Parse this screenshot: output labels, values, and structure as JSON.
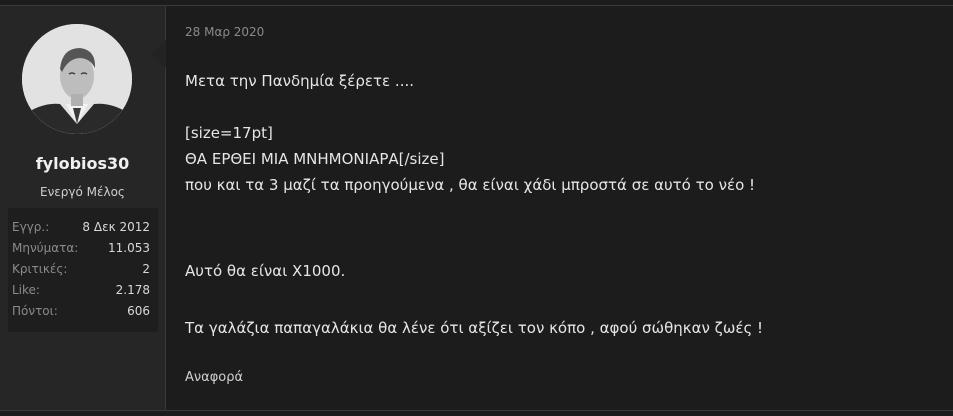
{
  "post": {
    "date": "28 Μαρ 2020",
    "lines": [
      "Μετα την Πανδημία ξέρετε ....",
      "[size=17pt]",
      "ΘΑ ΕΡΘΕΙ ΜΙΑ ΜΝΗΜΟΝΙΑΡΑ[/size]",
      "που και τα 3 μαζί τα προηγούμενα , θα είναι χάδι μπροστά σε αυτό το νέο !",
      "Αυτό θα είναι Χ1000.",
      "Τα γαλάζια παπαγαλάκια θα λένε ότι αξίζει τον κόπο , αφού σώθηκαν ζωές !"
    ],
    "report_label": "Αναφορά"
  },
  "user": {
    "name": "fylobios30",
    "title": "Ενεργό Μέλος",
    "stats": [
      {
        "label": "Εγγρ.:",
        "value": "8 Δεκ 2012"
      },
      {
        "label": "Μηνύματα:",
        "value": "11.053"
      },
      {
        "label": "Κριτικές:",
        "value": "2"
      },
      {
        "label": "Like:",
        "value": "2.178"
      },
      {
        "label": "Πόντοι:",
        "value": "606"
      }
    ]
  }
}
